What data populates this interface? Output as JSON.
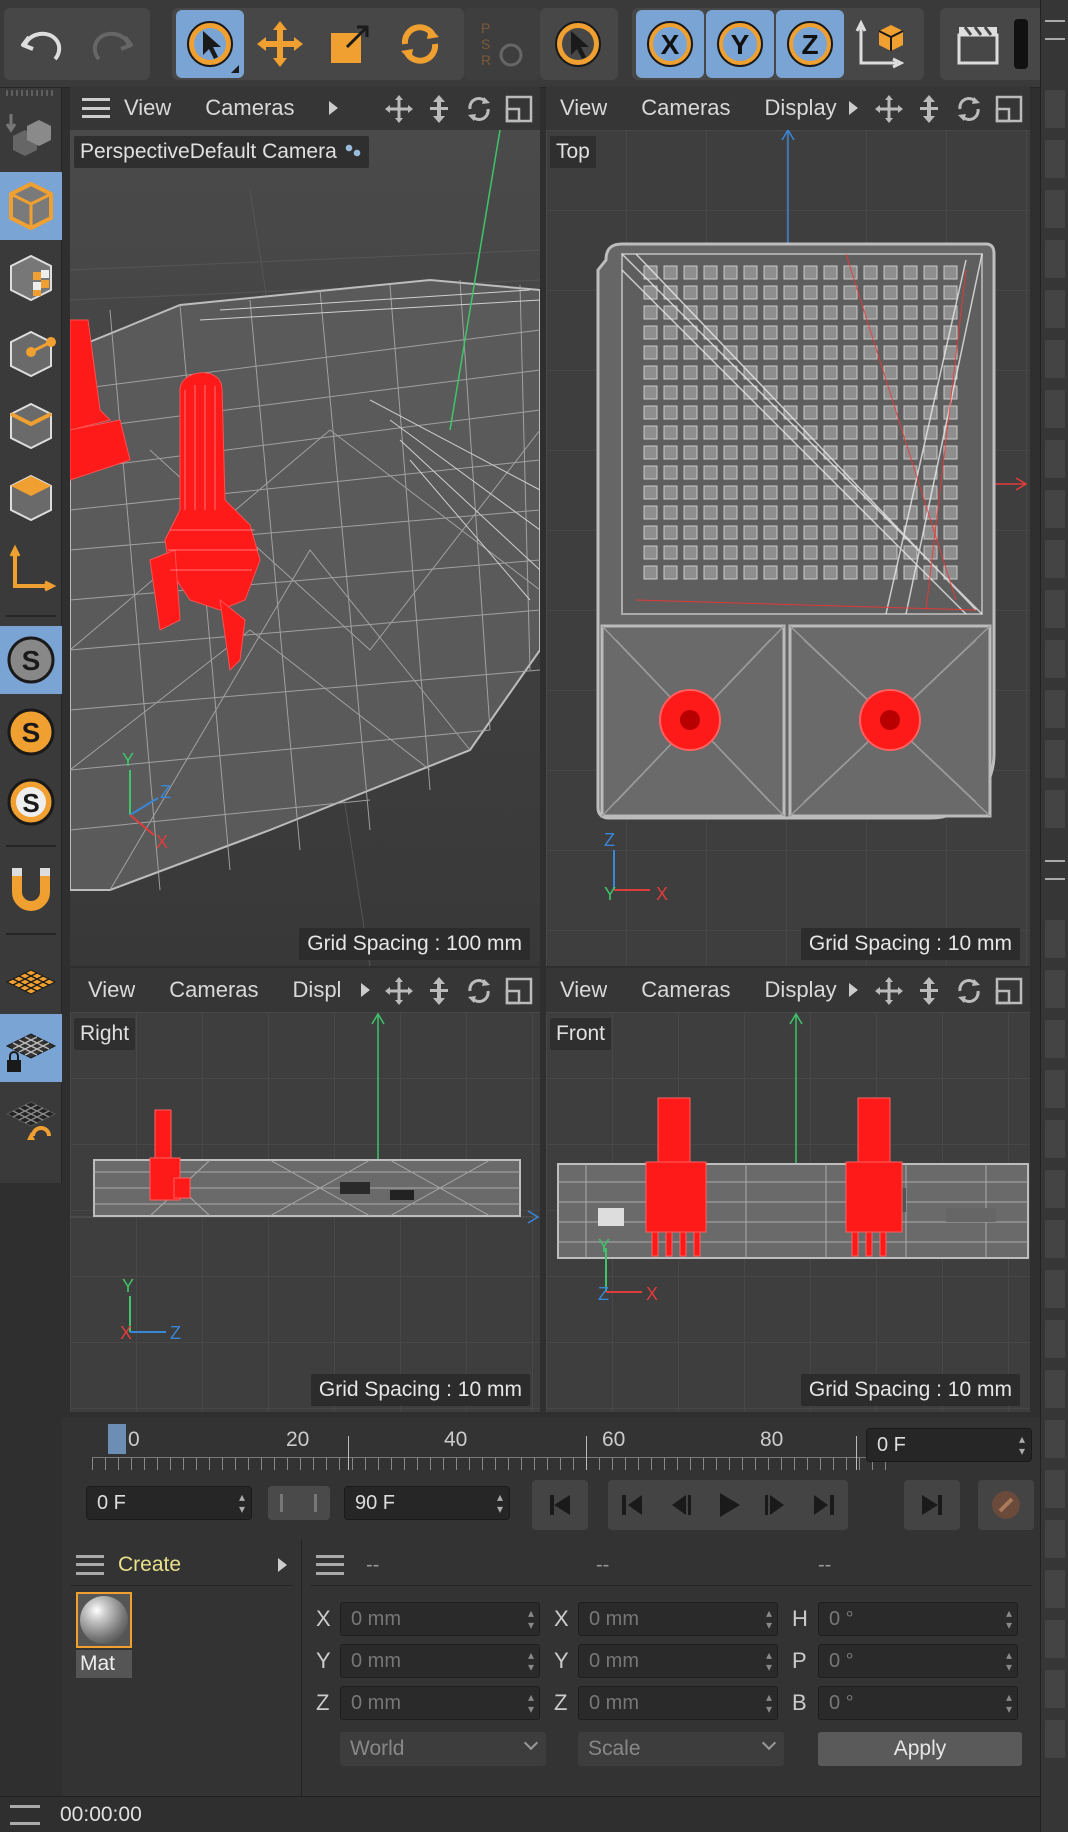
{
  "colors": {
    "accent_blue": "#7aa4d4",
    "accent_orange": "#f0a030",
    "wire_grey": "#b5b5b5",
    "highlight_red": "#ff1a1a",
    "axis_x": "#e03c3c",
    "axis_y": "#3fc46a",
    "axis_z": "#3a86d6",
    "create_text": "#e8e08a"
  },
  "toolbar": {
    "undo_icon": "undo-icon",
    "redo_icon": "redo-icon",
    "psr_letters": "PSR",
    "axis_x": "X",
    "axis_y": "Y",
    "axis_z": "Z"
  },
  "viewports": {
    "perspective": {
      "menu": [
        "View",
        "Cameras"
      ],
      "label_mode": "Perspective",
      "label_camera": "Default Camera",
      "grid": "Grid Spacing : 100 mm",
      "axes": {
        "y": "Y",
        "z": "Z",
        "x": "X"
      }
    },
    "top": {
      "menu": [
        "View",
        "Cameras",
        "Display"
      ],
      "label": "Top",
      "grid": "Grid Spacing : 10 mm",
      "axes": {
        "z": "Z",
        "y": "Y",
        "x": "X"
      }
    },
    "right": {
      "menu": [
        "View",
        "Cameras",
        "Displ"
      ],
      "label": "Right",
      "grid": "Grid Spacing : 10 mm",
      "axes": {
        "y": "Y",
        "x": "X",
        "z": "Z"
      }
    },
    "front": {
      "menu": [
        "View",
        "Cameras",
        "Display"
      ],
      "label": "Front",
      "grid": "Grid Spacing : 10 mm",
      "axes": {
        "y": "Y",
        "z": "Z",
        "x": "X"
      }
    }
  },
  "timeline": {
    "ruler_labels": [
      "0",
      "20",
      "40",
      "60",
      "80"
    ],
    "current_frame_right": "0 F",
    "start_frame": "0 F",
    "end_frame": "90 F"
  },
  "materials": {
    "create_label": "Create",
    "items": [
      {
        "name": "Mat"
      }
    ]
  },
  "coords": {
    "headers": [
      "--",
      "--",
      "--"
    ],
    "rows": [
      {
        "l1": "X",
        "v1": "0 mm",
        "l2": "X",
        "v2": "0 mm",
        "l3": "H",
        "v3": "0 °"
      },
      {
        "l1": "Y",
        "v1": "0 mm",
        "l2": "Y",
        "v2": "0 mm",
        "l3": "P",
        "v3": "0 °"
      },
      {
        "l1": "Z",
        "v1": "0 mm",
        "l2": "Z",
        "v2": "0 mm",
        "l3": "B",
        "v3": "0 °"
      }
    ],
    "space_dropdown": "World",
    "mode_dropdown": "Scale",
    "apply_label": "Apply"
  },
  "status": {
    "time": "00:00:00"
  }
}
